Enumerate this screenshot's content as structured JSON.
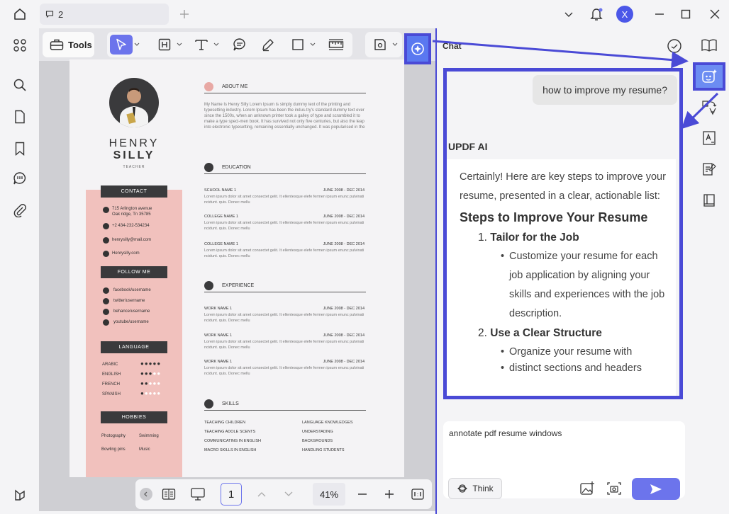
{
  "titlebar": {
    "tab_count": "2",
    "user_initial": "X"
  },
  "left_rail": {
    "icons": [
      "home-icon",
      "thumbnails-icon",
      "search-icon",
      "pages-icon",
      "bookmark-icon",
      "comment-icon",
      "attachment-icon",
      "layers-icon"
    ]
  },
  "toolbar": {
    "tools_label": "Tools"
  },
  "resume": {
    "first_name": "HENRY",
    "last_name": "SILLY",
    "role": "TEACHER",
    "contact_header": "CONTACT",
    "address": "715 Arlington avenue\nOak ridge, Tn 35785",
    "phone": "+2 434-232-534234",
    "email": "henrysilly@mail.com",
    "web": "Henrysilly.com",
    "follow_header": "FOLLOW ME",
    "social": [
      "facebook/username",
      "twitter/username",
      "behance/username",
      "youtube/username"
    ],
    "language_header": "LANGUAGE",
    "languages": [
      {
        "name": "ARABIC",
        "level": 5
      },
      {
        "name": "ENGLISH",
        "level": 3
      },
      {
        "name": "FRENCH",
        "level": 2
      },
      {
        "name": "SPANISH",
        "level": 1
      }
    ],
    "hobbies_header": "HOBBIES",
    "hobbies": [
      "Photography",
      "Swimming",
      "Bowling pins",
      "Music"
    ],
    "about_header": "ABOUT ME",
    "about_text": "My Name Is Henry Silly Lorem Ipsum is simply dummy text of the printing and typesetting industry. Lorem Ipsum has been the indus-try's standard dummy text ever since the 1500s, when an unknown printer took a galley of type and scrambled it to make a type speci-men book. It has survived not only five centuries, but also the leap into electronic typesetting, remaining essentially unchanged. It was popularised in the",
    "education_header": "EDUCATION",
    "education": [
      {
        "title": "SCHOOL NAME 1",
        "date": "JUNE 2008 - DEC 2014",
        "desc": "Lorem ipsum dolor sit amet consectet gelit. It ellentesque elefe fermen ipsum enunc pulvinati ncidunt. quis. Donec mellu"
      },
      {
        "title": "COLLEGE NAME 1",
        "date": "JUNE 2008 - DEC 2014",
        "desc": "Lorem ipsum dolor sit amet consectet gelit. It ellentesque elefe fermen ipsum enunc pulvinati ncidunt. quis. Donec mellu"
      },
      {
        "title": "COLLEGE NAME 1",
        "date": "JUNE 2008 - DEC 2014",
        "desc": "Lorem ipsum dolor sit amet consectet gelit. It ellentesque elefe fermen ipsum enunc pulvinati ncidunt. quis. Donec mellu"
      }
    ],
    "experience_header": "EXPERIENCE",
    "experience": [
      {
        "title": "WORK NAME 1",
        "date": "JUNE 2008 - DEC 2014",
        "desc": "Lorem ipsum dolor sit amet consectet gelit. It ellentesque elefe fermen ipsum enunc pulvinati ncidunt. quis. Donec mellu"
      },
      {
        "title": "WORK NAME 1",
        "date": "JUNE 2008 - DEC 2014",
        "desc": "Lorem ipsum dolor sit amet consectet gelit. It ellentesque elefe fermen ipsum enunc pulvinati ncidunt. quis. Donec mellu"
      },
      {
        "title": "WORK NAME 1",
        "date": "JUNE 2008 - DEC 2014",
        "desc": "Lorem ipsum dolor sit amet consectet gelit. It ellentesque elefe fermen ipsum enunc pulvinati ncidunt. quis. Donec mellu"
      }
    ],
    "skills_header": "SKILLS",
    "skills_left": [
      "TEACHING CHILDREN",
      "TEACHING ADOLE SCENTS",
      "COMMUNICATING IN ENGLISH",
      "MACRO SKILLS IN ENGLISH"
    ],
    "skills_right": [
      "LANGUAGE KNOWLEDGES",
      "UNDERSTADING",
      "BACKGROUNDS",
      "HANDLING STUDENTS"
    ]
  },
  "bottombar": {
    "page_number": "1",
    "zoom": "41%"
  },
  "chat": {
    "title": "Chat",
    "user_message": "how to improve my resume?",
    "ai_name": "UPDF AI",
    "answer_intro": "Certainly! Here are key steps to improve your resume, presented in a clear, actionable list:",
    "answer_heading": "Steps to Improve Your Resume",
    "steps": [
      {
        "num": "1.",
        "title": "Tailor for the Job",
        "bullet": "Customize your resume for each job application by aligning your skills and experiences with the job description."
      },
      {
        "num": "2.",
        "title": "Use a Clear Structure",
        "bullet": "Organize your resume with"
      }
    ],
    "answer_cut_text": "distinct sections and headers",
    "input_value": "annotate pdf resume windows",
    "think_label": "Think"
  },
  "colors": {
    "accent": "#6c74ec",
    "highlight_border": "#4a4ad6",
    "resume_pink": "#f1c1bd",
    "resume_dark": "#3a3a3c"
  }
}
